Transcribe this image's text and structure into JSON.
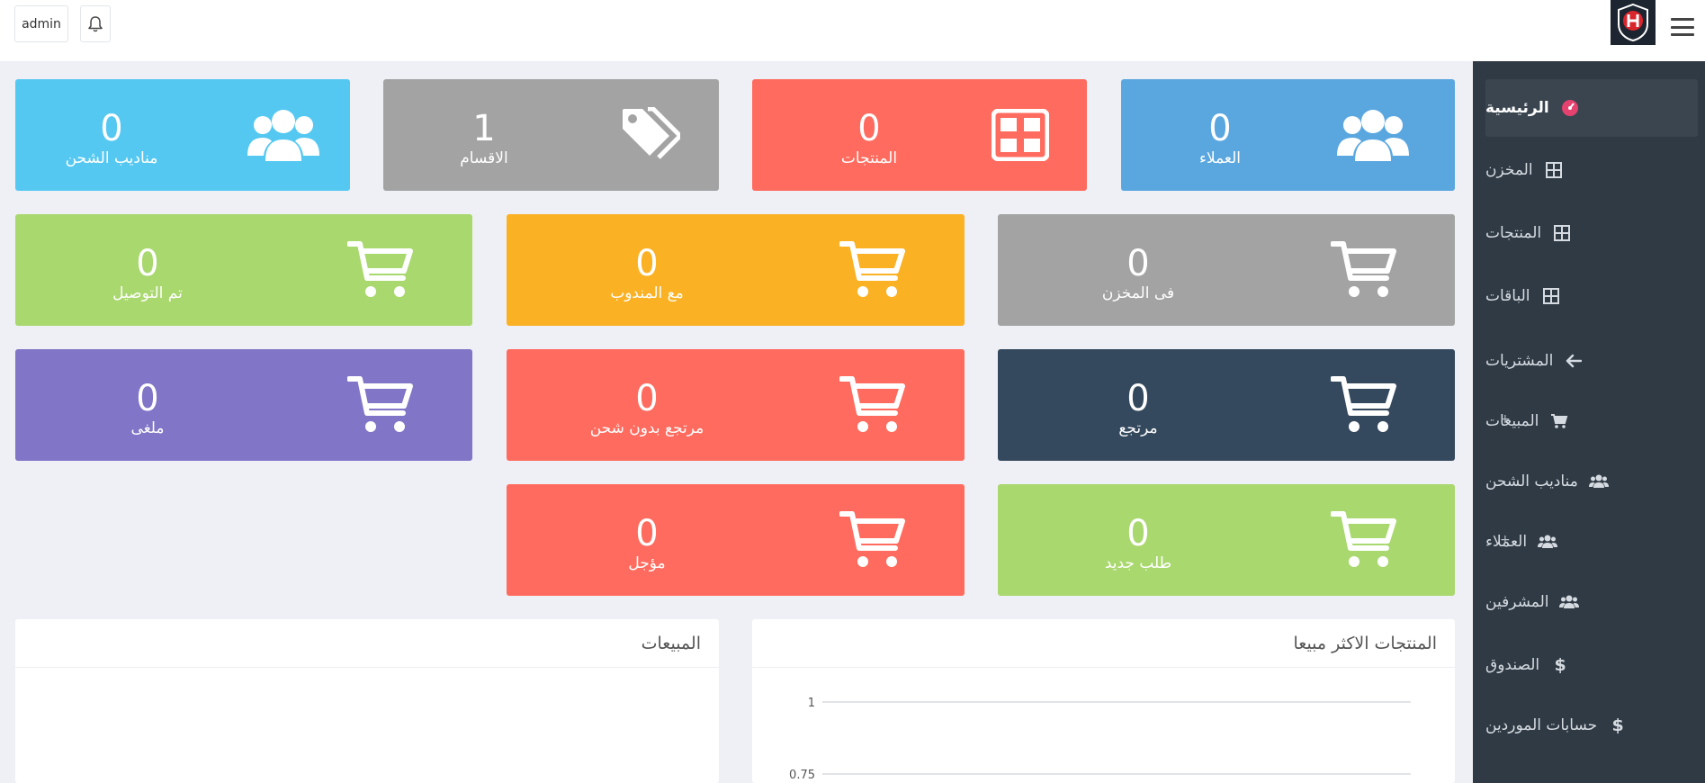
{
  "header": {
    "user_label": "admin"
  },
  "sidebar": {
    "items": [
      {
        "label": "الرئيسية",
        "icon": "dashboard-icon"
      },
      {
        "label": "المخزن",
        "icon": "grid-icon"
      },
      {
        "label": "المنتجات",
        "icon": "grid-icon"
      },
      {
        "label": "الباقات",
        "icon": "grid-icon"
      },
      {
        "label": "المشتريات",
        "icon": "arrow-left-icon"
      },
      {
        "label": "المبيعات",
        "icon": "cart-icon",
        "expand": "+"
      },
      {
        "label": "مناديب الشحن",
        "icon": "users-icon"
      },
      {
        "label": "العملاء",
        "icon": "users-icon",
        "expand": "+"
      },
      {
        "label": "المشرفين",
        "icon": "users-icon"
      },
      {
        "label": "الصندوق",
        "icon": "dollar-icon"
      },
      {
        "label": "حسابات الموردين",
        "icon": "dollar-icon"
      }
    ]
  },
  "stats_top": [
    {
      "value": "0",
      "label": "العملاء",
      "color": "#5aa7e0",
      "icon": "users-icon"
    },
    {
      "value": "0",
      "label": "المنتجات",
      "color": "#ff6b5e",
      "icon": "grid-icon"
    },
    {
      "value": "1",
      "label": "الاقسام",
      "color": "#a3a3a3",
      "icon": "tags-icon"
    },
    {
      "value": "0",
      "label": "مناديب الشحن",
      "color": "#55c8f2",
      "icon": "users-icon"
    }
  ],
  "stats_orders": [
    {
      "value": "0",
      "label": "فى المخزن",
      "color": "#a3a3a3"
    },
    {
      "value": "0",
      "label": "مع المندوب",
      "color": "#fbb124"
    },
    {
      "value": "0",
      "label": "تم التوصيل",
      "color": "#a9d86e"
    },
    {
      "value": "0",
      "label": "مرتجع",
      "color": "#34495e"
    },
    {
      "value": "0",
      "label": "مرتجع بدون شحن",
      "color": "#ff6b5e"
    },
    {
      "value": "0",
      "label": "ملغى",
      "color": "#8175c7"
    },
    {
      "value": "0",
      "label": "طلب جديد",
      "color": "#a9d86e"
    },
    {
      "value": "0",
      "label": "مؤجل",
      "color": "#ff6b5e"
    }
  ],
  "panels": {
    "best_sellers_title": "المنتجات الاكثر مبيعا",
    "sales_title": "المبيعات"
  },
  "chart_data": {
    "type": "bar",
    "title": "المنتجات الاكثر مبيعا",
    "y_tick_labels": [
      "1",
      "0.75"
    ],
    "ylim": [
      0,
      1
    ],
    "categories": [],
    "values": [],
    "grid": true
  }
}
